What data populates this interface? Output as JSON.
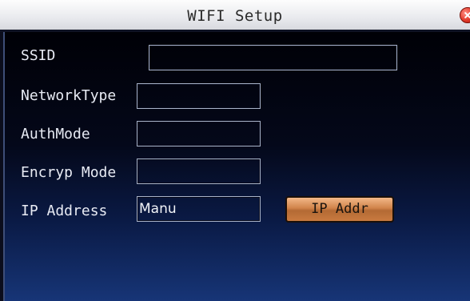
{
  "window": {
    "title": "WIFI Setup"
  },
  "form": {
    "ssid": {
      "label": "SSID",
      "value": ""
    },
    "network_type": {
      "label": "NetworkType",
      "value": ""
    },
    "auth_mode": {
      "label": "AuthMode",
      "value": ""
    },
    "encryp_mode": {
      "label": "Encryp Mode",
      "value": ""
    },
    "ip_address": {
      "label": "IP Address",
      "value": "Manu"
    }
  },
  "buttons": {
    "ip_addr": "IP Addr"
  },
  "icons": {
    "close": "close-icon"
  },
  "colors": {
    "accent_button": "#d0834a",
    "close": "#e23a2a",
    "background_bottom": "#173577"
  }
}
